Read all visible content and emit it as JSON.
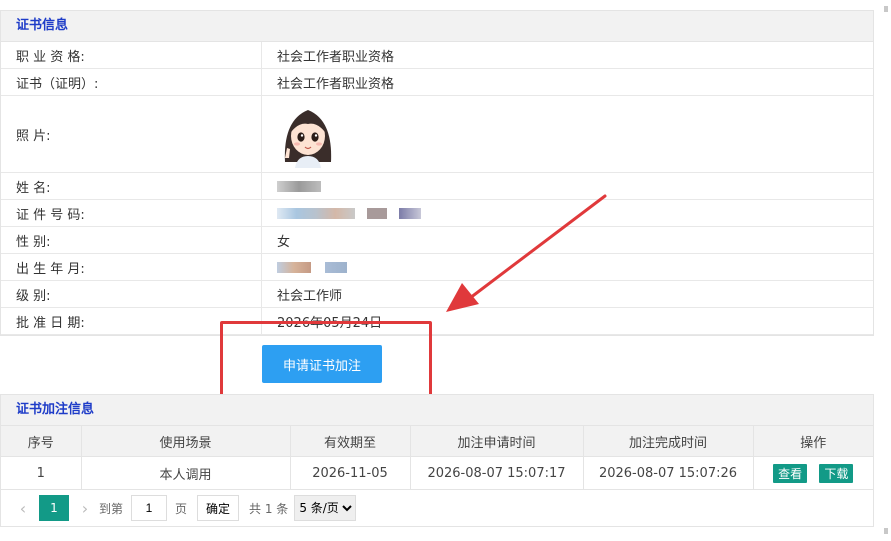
{
  "cert_panel": {
    "title": "证书信息",
    "rows": [
      {
        "label": "职 业 资 格:",
        "value": "社会工作者职业资格"
      },
      {
        "label": "证书（证明）:",
        "value": "社会工作者职业资格"
      },
      {
        "label": "照          片:",
        "value": ""
      },
      {
        "label": "姓          名:",
        "value": ""
      },
      {
        "label": "证 件 号 码:",
        "value": ""
      },
      {
        "label": "性          别:",
        "value": "女"
      },
      {
        "label": "出 生 年 月:",
        "value": ""
      },
      {
        "label": "级          别:",
        "value": "社会工作师"
      },
      {
        "label": "批 准 日 期:",
        "value": "2026年05月24日"
      }
    ]
  },
  "apply_button": {
    "label": "申请证书加注"
  },
  "annot_panel": {
    "title": "证书加注信息",
    "columns": [
      "序号",
      "使用场景",
      "有效期至",
      "加注申请时间",
      "加注完成时间",
      "操作"
    ],
    "rows": [
      {
        "index": "1",
        "scene": "本人调用",
        "valid_until": "2026-11-05",
        "apply_time": "2026-08-07 15:07:17",
        "done_time": "2026-08-07 15:07:26",
        "view_label": "查看",
        "download_label": "下载"
      }
    ]
  },
  "pager": {
    "prev": "‹",
    "current": "1",
    "next": "›",
    "goto_label": "到第",
    "goto_value": "1",
    "page_unit": "页",
    "confirm_label": "确定",
    "total_label": "共 1 条",
    "page_size": "5 条/页"
  },
  "colors": {
    "accent": "#2d9ff2",
    "teal": "#129a87",
    "annotation_red": "#e0393b",
    "title_blue": "#1e3cc8"
  }
}
